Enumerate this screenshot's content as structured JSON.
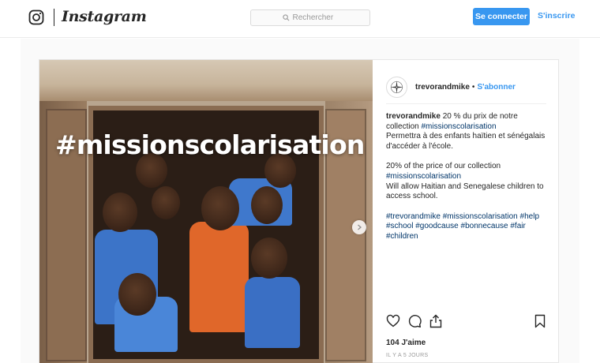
{
  "header": {
    "brand": "Instagram",
    "search_placeholder": "Rechercher",
    "login_label": "Se connecter",
    "signup_label": "S'inscrire"
  },
  "post": {
    "image_overlay_text": "#missionscolarisation",
    "username": "trevorandmike",
    "separator": "•",
    "follow_label": "S'abonner",
    "caption_fr_text": "20 % du prix de notre collection",
    "caption_fr_tag": "#missionscolarisation",
    "caption_fr_line2": "Permettra à des enfants haïtien et sénégalais d'accéder à l'école.",
    "caption_en_line1": "20% of the price of our collection",
    "caption_en_tag": "#missionscolarisation",
    "caption_en_line2": "Will allow Haitian and Senegalese children to access school.",
    "tags": [
      "#trevorandmike",
      "#missionscolarisation",
      "#help",
      "#school",
      "#goodcause",
      "#bonnecause",
      "#fair",
      "#children"
    ],
    "likes": "104 J'aime",
    "timestamp": "IL Y A 5 JOURS"
  },
  "icons": {
    "logo": "instagram-camera-icon",
    "search": "search-icon",
    "avatar": "compass-rose-icon",
    "like": "heart-icon",
    "comment": "comment-icon",
    "share": "share-icon",
    "save": "bookmark-icon",
    "carousel_next": "chevron-right-icon"
  },
  "colors": {
    "accent": "#3897f0",
    "hashtag_link": "#003569",
    "text": "#262626"
  }
}
